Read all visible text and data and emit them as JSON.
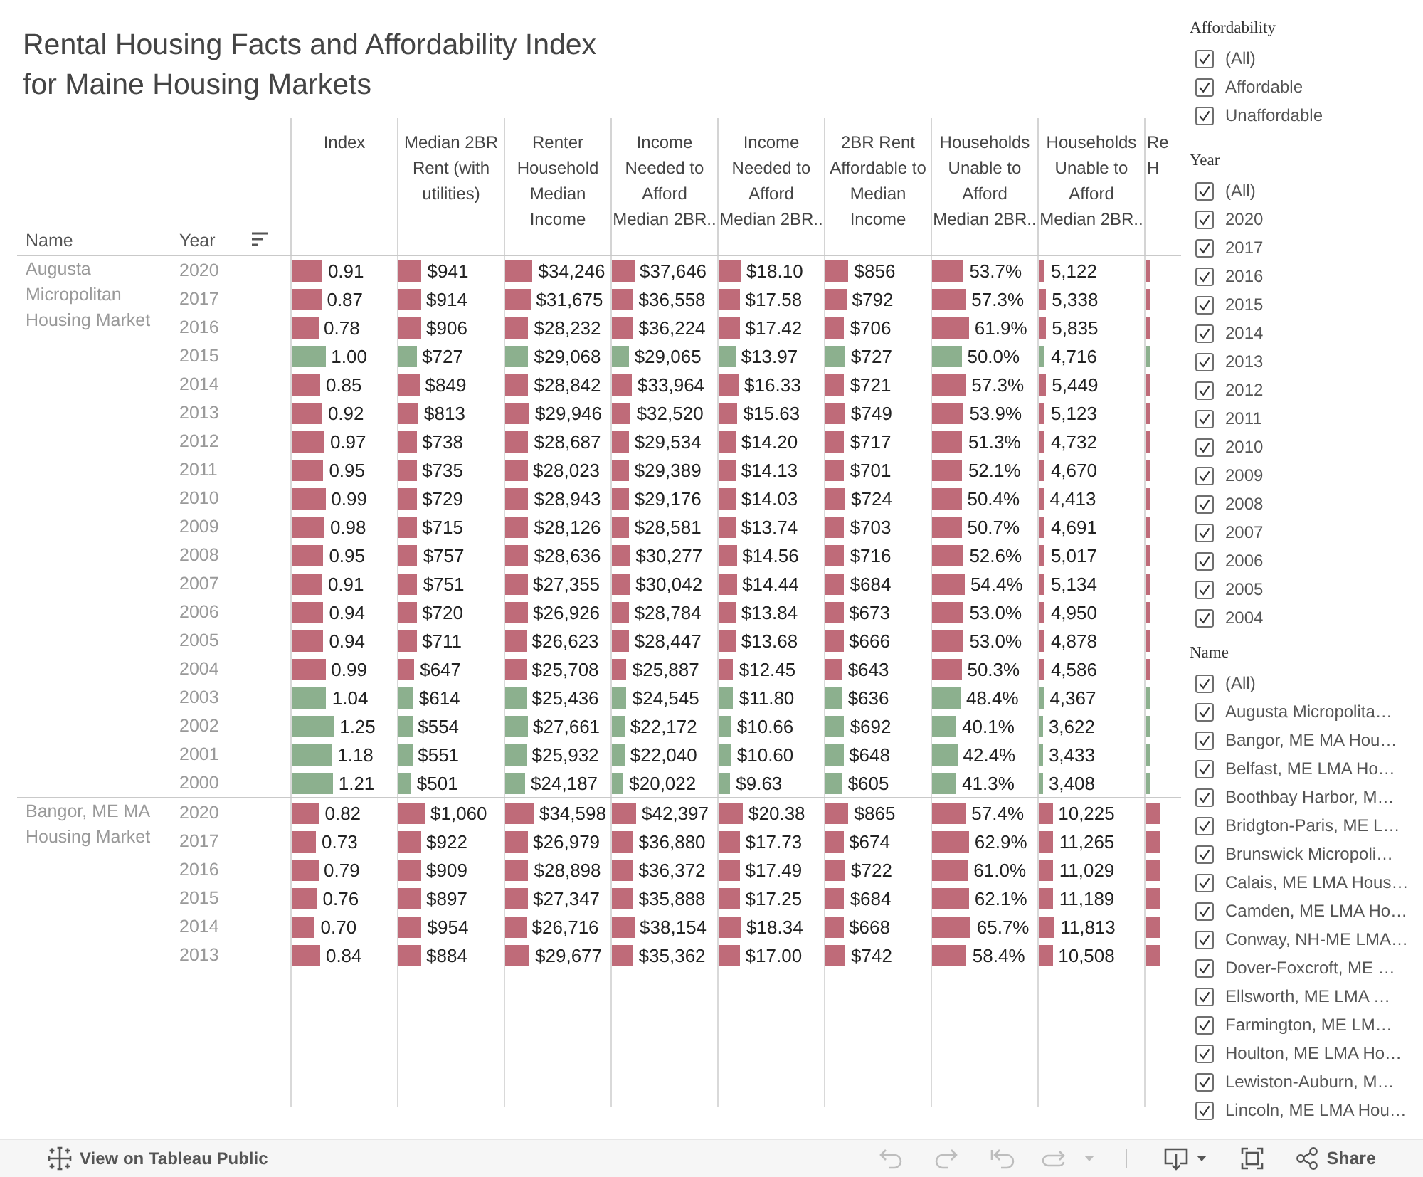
{
  "title": "Rental Housing Facts and Affordability Index\nfor Maine Housing Markets",
  "table": {
    "row_headers": [
      "Name",
      "Year"
    ],
    "columns": [
      "Index",
      "Median 2BR\nRent (with\nutilities)",
      "Renter\nHousehold\nMedian\nIncome",
      "Income\nNeeded to\nAfford\nMedian 2BR..",
      "Income\nNeeded to\nAfford\nMedian 2BR..",
      "2BR Rent\nAffordable to\nMedian\nIncome",
      "Households\nUnable to\nAfford\nMedian 2BR..",
      "Households\nUnable to\nAfford\nMedian 2BR..",
      "Re\nH"
    ],
    "groups": [
      {
        "name": "Augusta Micropolitan Housing Market",
        "rows": [
          {
            "year": "2020",
            "affordable": false,
            "cells": [
              {
                "value": "0.91",
                "level": 0.29
              },
              {
                "value": "$941",
                "level": 0.22
              },
              {
                "value": "$34,246",
                "level": 0.26
              },
              {
                "value": "$37,646",
                "level": 0.21
              },
              {
                "value": "$18.10",
                "level": 0.21
              },
              {
                "value": "$856",
                "level": 0.22
              },
              {
                "value": "53.7%",
                "level": 0.3
              },
              {
                "value": "5,122",
                "level": 0.06
              },
              {
                "level": 0.04
              }
            ]
          },
          {
            "year": "2017",
            "affordable": false,
            "cells": [
              {
                "value": "0.87",
                "level": 0.28
              },
              {
                "value": "$914",
                "level": 0.21
              },
              {
                "value": "$31,675",
                "level": 0.24
              },
              {
                "value": "$36,558",
                "level": 0.2
              },
              {
                "value": "$17.58",
                "level": 0.2
              },
              {
                "value": "$792",
                "level": 0.2
              },
              {
                "value": "57.3%",
                "level": 0.32
              },
              {
                "value": "5,338",
                "level": 0.07
              },
              {
                "level": 0.04
              }
            ]
          },
          {
            "year": "2016",
            "affordable": false,
            "cells": [
              {
                "value": "0.78",
                "level": 0.25
              },
              {
                "value": "$906",
                "level": 0.21
              },
              {
                "value": "$28,232",
                "level": 0.22
              },
              {
                "value": "$36,224",
                "level": 0.2
              },
              {
                "value": "$17.42",
                "level": 0.2
              },
              {
                "value": "$706",
                "level": 0.18
              },
              {
                "value": "61.9%",
                "level": 0.35
              },
              {
                "value": "5,835",
                "level": 0.07
              },
              {
                "level": 0.04
              }
            ]
          },
          {
            "year": "2015",
            "affordable": true,
            "cells": [
              {
                "value": "1.00",
                "level": 0.32
              },
              {
                "value": "$727",
                "level": 0.17
              },
              {
                "value": "$29,068",
                "level": 0.22
              },
              {
                "value": "$29,065",
                "level": 0.16
              },
              {
                "value": "$13.97",
                "level": 0.16
              },
              {
                "value": "$727",
                "level": 0.19
              },
              {
                "value": "50.0%",
                "level": 0.28
              },
              {
                "value": "4,716",
                "level": 0.06
              },
              {
                "level": 0.04
              }
            ]
          },
          {
            "year": "2014",
            "affordable": false,
            "cells": [
              {
                "value": "0.85",
                "level": 0.27
              },
              {
                "value": "$849",
                "level": 0.2
              },
              {
                "value": "$28,842",
                "level": 0.22
              },
              {
                "value": "$33,964",
                "level": 0.19
              },
              {
                "value": "$16.33",
                "level": 0.19
              },
              {
                "value": "$721",
                "level": 0.18
              },
              {
                "value": "57.3%",
                "level": 0.32
              },
              {
                "value": "5,449",
                "level": 0.07
              },
              {
                "level": 0.04
              }
            ]
          },
          {
            "year": "2013",
            "affordable": false,
            "cells": [
              {
                "value": "0.92",
                "level": 0.29
              },
              {
                "value": "$813",
                "level": 0.19
              },
              {
                "value": "$29,946",
                "level": 0.23
              },
              {
                "value": "$32,520",
                "level": 0.18
              },
              {
                "value": "$15.63",
                "level": 0.18
              },
              {
                "value": "$749",
                "level": 0.19
              },
              {
                "value": "53.9%",
                "level": 0.3
              },
              {
                "value": "5,123",
                "level": 0.06
              },
              {
                "level": 0.04
              }
            ]
          },
          {
            "year": "2012",
            "affordable": false,
            "cells": [
              {
                "value": "0.97",
                "level": 0.31
              },
              {
                "value": "$738",
                "level": 0.17
              },
              {
                "value": "$28,687",
                "level": 0.22
              },
              {
                "value": "$29,534",
                "level": 0.16
              },
              {
                "value": "$14.20",
                "level": 0.16
              },
              {
                "value": "$717",
                "level": 0.18
              },
              {
                "value": "51.3%",
                "level": 0.29
              },
              {
                "value": "4,732",
                "level": 0.06
              },
              {
                "level": 0.04
              }
            ]
          },
          {
            "year": "2011",
            "affordable": false,
            "cells": [
              {
                "value": "0.95",
                "level": 0.3
              },
              {
                "value": "$735",
                "level": 0.17
              },
              {
                "value": "$28,023",
                "level": 0.21
              },
              {
                "value": "$29,389",
                "level": 0.16
              },
              {
                "value": "$14.13",
                "level": 0.16
              },
              {
                "value": "$701",
                "level": 0.18
              },
              {
                "value": "52.1%",
                "level": 0.29
              },
              {
                "value": "4,670",
                "level": 0.06
              },
              {
                "level": 0.04
              }
            ]
          },
          {
            "year": "2010",
            "affordable": false,
            "cells": [
              {
                "value": "0.99",
                "level": 0.32
              },
              {
                "value": "$729",
                "level": 0.17
              },
              {
                "value": "$28,943",
                "level": 0.22
              },
              {
                "value": "$29,176",
                "level": 0.16
              },
              {
                "value": "$14.03",
                "level": 0.16
              },
              {
                "value": "$724",
                "level": 0.19
              },
              {
                "value": "50.4%",
                "level": 0.28
              },
              {
                "value": "4,413",
                "level": 0.05
              },
              {
                "level": 0.04
              }
            ]
          },
          {
            "year": "2009",
            "affordable": false,
            "cells": [
              {
                "value": "0.98",
                "level": 0.31
              },
              {
                "value": "$715",
                "level": 0.17
              },
              {
                "value": "$28,126",
                "level": 0.22
              },
              {
                "value": "$28,581",
                "level": 0.16
              },
              {
                "value": "$13.74",
                "level": 0.16
              },
              {
                "value": "$703",
                "level": 0.18
              },
              {
                "value": "50.7%",
                "level": 0.28
              },
              {
                "value": "4,691",
                "level": 0.06
              },
              {
                "level": 0.04
              }
            ]
          },
          {
            "year": "2008",
            "affordable": false,
            "cells": [
              {
                "value": "0.95",
                "level": 0.3
              },
              {
                "value": "$757",
                "level": 0.18
              },
              {
                "value": "$28,636",
                "level": 0.22
              },
              {
                "value": "$30,277",
                "level": 0.17
              },
              {
                "value": "$14.56",
                "level": 0.17
              },
              {
                "value": "$716",
                "level": 0.18
              },
              {
                "value": "52.6%",
                "level": 0.3
              },
              {
                "value": "5,017",
                "level": 0.06
              },
              {
                "level": 0.04
              }
            ]
          },
          {
            "year": "2007",
            "affordable": false,
            "cells": [
              {
                "value": "0.91",
                "level": 0.29
              },
              {
                "value": "$751",
                "level": 0.18
              },
              {
                "value": "$27,355",
                "level": 0.21
              },
              {
                "value": "$30,042",
                "level": 0.17
              },
              {
                "value": "$14.44",
                "level": 0.17
              },
              {
                "value": "$684",
                "level": 0.18
              },
              {
                "value": "54.4%",
                "level": 0.31
              },
              {
                "value": "5,134",
                "level": 0.06
              },
              {
                "level": 0.04
              }
            ]
          },
          {
            "year": "2006",
            "affordable": false,
            "cells": [
              {
                "value": "0.94",
                "level": 0.3
              },
              {
                "value": "$720",
                "level": 0.17
              },
              {
                "value": "$26,926",
                "level": 0.21
              },
              {
                "value": "$28,784",
                "level": 0.16
              },
              {
                "value": "$13.84",
                "level": 0.16
              },
              {
                "value": "$673",
                "level": 0.17
              },
              {
                "value": "53.0%",
                "level": 0.3
              },
              {
                "value": "4,950",
                "level": 0.06
              },
              {
                "level": 0.04
              }
            ]
          },
          {
            "year": "2005",
            "affordable": false,
            "cells": [
              {
                "value": "0.94",
                "level": 0.3
              },
              {
                "value": "$711",
                "level": 0.17
              },
              {
                "value": "$26,623",
                "level": 0.2
              },
              {
                "value": "$28,447",
                "level": 0.16
              },
              {
                "value": "$13.68",
                "level": 0.16
              },
              {
                "value": "$666",
                "level": 0.17
              },
              {
                "value": "53.0%",
                "level": 0.3
              },
              {
                "value": "4,878",
                "level": 0.06
              },
              {
                "level": 0.04
              }
            ]
          },
          {
            "year": "2004",
            "affordable": false,
            "cells": [
              {
                "value": "0.99",
                "level": 0.32
              },
              {
                "value": "$647",
                "level": 0.15
              },
              {
                "value": "$25,708",
                "level": 0.2
              },
              {
                "value": "$25,887",
                "level": 0.14
              },
              {
                "value": "$12.45",
                "level": 0.14
              },
              {
                "value": "$643",
                "level": 0.16
              },
              {
                "value": "50.3%",
                "level": 0.28
              },
              {
                "value": "4,586",
                "level": 0.06
              },
              {
                "level": 0.04
              }
            ]
          },
          {
            "year": "2003",
            "affordable": true,
            "cells": [
              {
                "value": "1.04",
                "level": 0.33
              },
              {
                "value": "$614",
                "level": 0.14
              },
              {
                "value": "$25,436",
                "level": 0.2
              },
              {
                "value": "$24,545",
                "level": 0.14
              },
              {
                "value": "$11.80",
                "level": 0.14
              },
              {
                "value": "$636",
                "level": 0.16
              },
              {
                "value": "48.4%",
                "level": 0.27
              },
              {
                "value": "4,367",
                "level": 0.05
              },
              {
                "level": 0.04
              }
            ]
          },
          {
            "year": "2002",
            "affordable": true,
            "cells": [
              {
                "value": "1.25",
                "level": 0.4
              },
              {
                "value": "$554",
                "level": 0.13
              },
              {
                "value": "$27,661",
                "level": 0.21
              },
              {
                "value": "$22,172",
                "level": 0.12
              },
              {
                "value": "$10.66",
                "level": 0.12
              },
              {
                "value": "$692",
                "level": 0.18
              },
              {
                "value": "40.1%",
                "level": 0.23
              },
              {
                "value": "3,622",
                "level": 0.04
              },
              {
                "level": 0.04
              }
            ]
          },
          {
            "year": "2001",
            "affordable": true,
            "cells": [
              {
                "value": "1.18",
                "level": 0.38
              },
              {
                "value": "$551",
                "level": 0.13
              },
              {
                "value": "$25,932",
                "level": 0.2
              },
              {
                "value": "$22,040",
                "level": 0.12
              },
              {
                "value": "$10.60",
                "level": 0.12
              },
              {
                "value": "$648",
                "level": 0.17
              },
              {
                "value": "42.4%",
                "level": 0.24
              },
              {
                "value": "3,433",
                "level": 0.04
              },
              {
                "level": 0.04
              }
            ]
          },
          {
            "year": "2000",
            "affordable": true,
            "cells": [
              {
                "value": "1.21",
                "level": 0.39
              },
              {
                "value": "$501",
                "level": 0.12
              },
              {
                "value": "$24,187",
                "level": 0.19
              },
              {
                "value": "$20,022",
                "level": 0.11
              },
              {
                "value": "$9.63",
                "level": 0.11
              },
              {
                "value": "$605",
                "level": 0.16
              },
              {
                "value": "41.3%",
                "level": 0.23
              },
              {
                "value": "3,408",
                "level": 0.04
              },
              {
                "level": 0.04
              }
            ]
          }
        ]
      },
      {
        "name": "Bangor, ME MA Housing Market",
        "rows": [
          {
            "year": "2020",
            "affordable": false,
            "cells": [
              {
                "value": "0.82",
                "level": 0.26
              },
              {
                "value": "$1,060",
                "level": 0.25
              },
              {
                "value": "$34,598",
                "level": 0.27
              },
              {
                "value": "$42,397",
                "level": 0.23
              },
              {
                "value": "$20.38",
                "level": 0.23
              },
              {
                "value": "$865",
                "level": 0.22
              },
              {
                "value": "57.4%",
                "level": 0.32
              },
              {
                "value": "10,225",
                "level": 0.13
              },
              {
                "level": 0.14
              }
            ]
          },
          {
            "year": "2017",
            "affordable": false,
            "cells": [
              {
                "value": "0.73",
                "level": 0.23
              },
              {
                "value": "$922",
                "level": 0.21
              },
              {
                "value": "$26,979",
                "level": 0.21
              },
              {
                "value": "$36,880",
                "level": 0.2
              },
              {
                "value": "$17.73",
                "level": 0.2
              },
              {
                "value": "$674",
                "level": 0.17
              },
              {
                "value": "62.9%",
                "level": 0.35
              },
              {
                "value": "11,265",
                "level": 0.14
              },
              {
                "level": 0.14
              }
            ]
          },
          {
            "year": "2016",
            "affordable": false,
            "cells": [
              {
                "value": "0.79",
                "level": 0.25
              },
              {
                "value": "$909",
                "level": 0.21
              },
              {
                "value": "$28,898",
                "level": 0.22
              },
              {
                "value": "$36,372",
                "level": 0.2
              },
              {
                "value": "$17.49",
                "level": 0.2
              },
              {
                "value": "$722",
                "level": 0.19
              },
              {
                "value": "61.0%",
                "level": 0.34
              },
              {
                "value": "11,029",
                "level": 0.14
              },
              {
                "level": 0.14
              }
            ]
          },
          {
            "year": "2015",
            "affordable": false,
            "cells": [
              {
                "value": "0.76",
                "level": 0.24
              },
              {
                "value": "$897",
                "level": 0.21
              },
              {
                "value": "$27,347",
                "level": 0.21
              },
              {
                "value": "$35,888",
                "level": 0.2
              },
              {
                "value": "$17.25",
                "level": 0.2
              },
              {
                "value": "$684",
                "level": 0.18
              },
              {
                "value": "62.1%",
                "level": 0.35
              },
              {
                "value": "11,189",
                "level": 0.14
              },
              {
                "level": 0.14
              }
            ]
          },
          {
            "year": "2014",
            "affordable": false,
            "cells": [
              {
                "value": "0.70",
                "level": 0.22
              },
              {
                "value": "$954",
                "level": 0.22
              },
              {
                "value": "$26,716",
                "level": 0.2
              },
              {
                "value": "$38,154",
                "level": 0.21
              },
              {
                "value": "$18.34",
                "level": 0.21
              },
              {
                "value": "$668",
                "level": 0.17
              },
              {
                "value": "65.7%",
                "level": 0.37
              },
              {
                "value": "11,813",
                "level": 0.15
              },
              {
                "level": 0.14
              }
            ]
          },
          {
            "year": "2013",
            "affordable": false,
            "cells": [
              {
                "value": "0.84",
                "level": 0.27
              },
              {
                "value": "$884",
                "level": 0.21
              },
              {
                "value": "$29,677",
                "level": 0.23
              },
              {
                "value": "$35,362",
                "level": 0.2
              },
              {
                "value": "$17.00",
                "level": 0.2
              },
              {
                "value": "$742",
                "level": 0.19
              },
              {
                "value": "58.4%",
                "level": 0.33
              },
              {
                "value": "10,508",
                "level": 0.13
              },
              {
                "level": 0.14
              }
            ]
          }
        ]
      }
    ]
  },
  "filters": [
    {
      "title": "Affordability",
      "items": [
        {
          "label": "(All)",
          "checked": true
        },
        {
          "label": "Affordable",
          "checked": true
        },
        {
          "label": "Unaffordable",
          "checked": true
        }
      ]
    },
    {
      "title": "Year",
      "items": [
        {
          "label": "(All)",
          "checked": true
        },
        {
          "label": "2020",
          "checked": true
        },
        {
          "label": "2017",
          "checked": true
        },
        {
          "label": "2016",
          "checked": true
        },
        {
          "label": "2015",
          "checked": true
        },
        {
          "label": "2014",
          "checked": true
        },
        {
          "label": "2013",
          "checked": true
        },
        {
          "label": "2012",
          "checked": true
        },
        {
          "label": "2011",
          "checked": true
        },
        {
          "label": "2010",
          "checked": true
        },
        {
          "label": "2009",
          "checked": true
        },
        {
          "label": "2008",
          "checked": true
        },
        {
          "label": "2007",
          "checked": true
        },
        {
          "label": "2006",
          "checked": true
        },
        {
          "label": "2005",
          "checked": true
        },
        {
          "label": "2004",
          "checked": true
        }
      ]
    },
    {
      "title": "Name",
      "items": [
        {
          "label": "(All)",
          "checked": true
        },
        {
          "label": "Augusta Micropolita…",
          "checked": true
        },
        {
          "label": "Bangor, ME MA Hou…",
          "checked": true
        },
        {
          "label": "Belfast, ME LMA Ho…",
          "checked": true
        },
        {
          "label": "Boothbay Harbor, M…",
          "checked": true
        },
        {
          "label": "Bridgton-Paris, ME L…",
          "checked": true
        },
        {
          "label": "Brunswick Micropoli…",
          "checked": true
        },
        {
          "label": "Calais, ME LMA Hous…",
          "checked": true
        },
        {
          "label": "Camden, ME LMA Ho…",
          "checked": true
        },
        {
          "label": "Conway, NH-ME LMA…",
          "checked": true
        },
        {
          "label": "Dover-Foxcroft, ME …",
          "checked": true
        },
        {
          "label": "Ellsworth, ME LMA …",
          "checked": true
        },
        {
          "label": "Farmington, ME LM…",
          "checked": true
        },
        {
          "label": "Houlton, ME LMA Ho…",
          "checked": true
        },
        {
          "label": "Lewiston-Auburn, M…",
          "checked": true
        },
        {
          "label": "Lincoln, ME LMA Hou…",
          "checked": true
        }
      ]
    }
  ],
  "toolbar": {
    "link": "View on Tableau Public",
    "history_buttons": [
      {
        "kind": "undo",
        "disabled": true
      },
      {
        "kind": "redo",
        "disabled": true
      },
      {
        "kind": "revert",
        "disabled": true
      },
      {
        "kind": "refresh",
        "disabled": true
      }
    ],
    "view_buttons": [
      {
        "kind": "download",
        "disabled": false
      },
      {
        "kind": "fullscreen",
        "disabled": false
      },
      {
        "kind": "share",
        "label": "Share",
        "disabled": false
      }
    ]
  }
}
